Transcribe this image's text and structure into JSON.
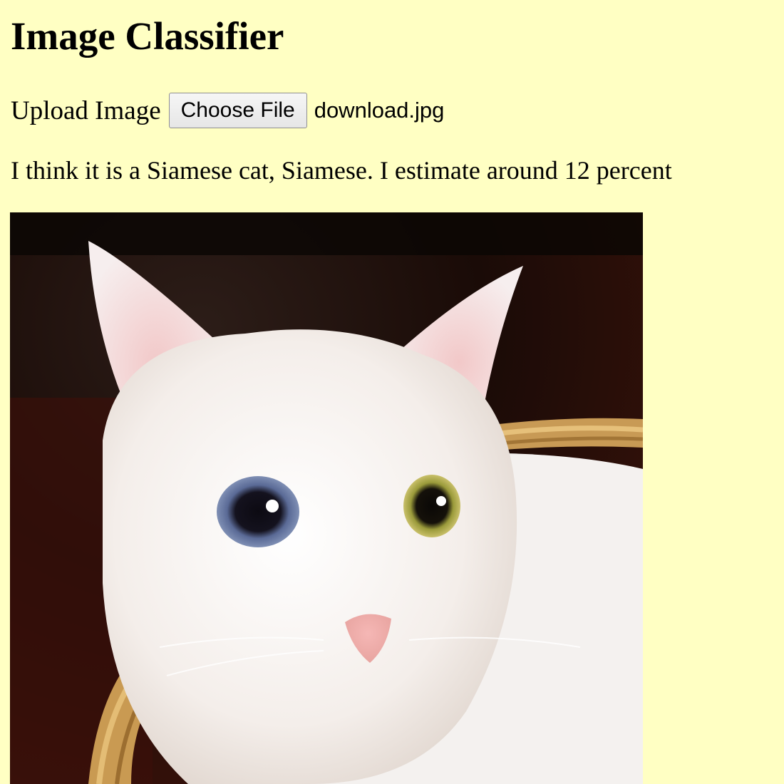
{
  "page": {
    "title": "Image Classifier"
  },
  "upload": {
    "label": "Upload Image",
    "button_label": "Choose File",
    "file_name": "download.jpg"
  },
  "result": {
    "text": "I think it is a Siamese cat, Siamese. I estimate around 12 percent"
  },
  "preview": {
    "subject": "white cat with one blue eye and one yellow-green eye in a wicker basket"
  },
  "colors": {
    "background": "#ffffc3",
    "text": "#000000"
  }
}
